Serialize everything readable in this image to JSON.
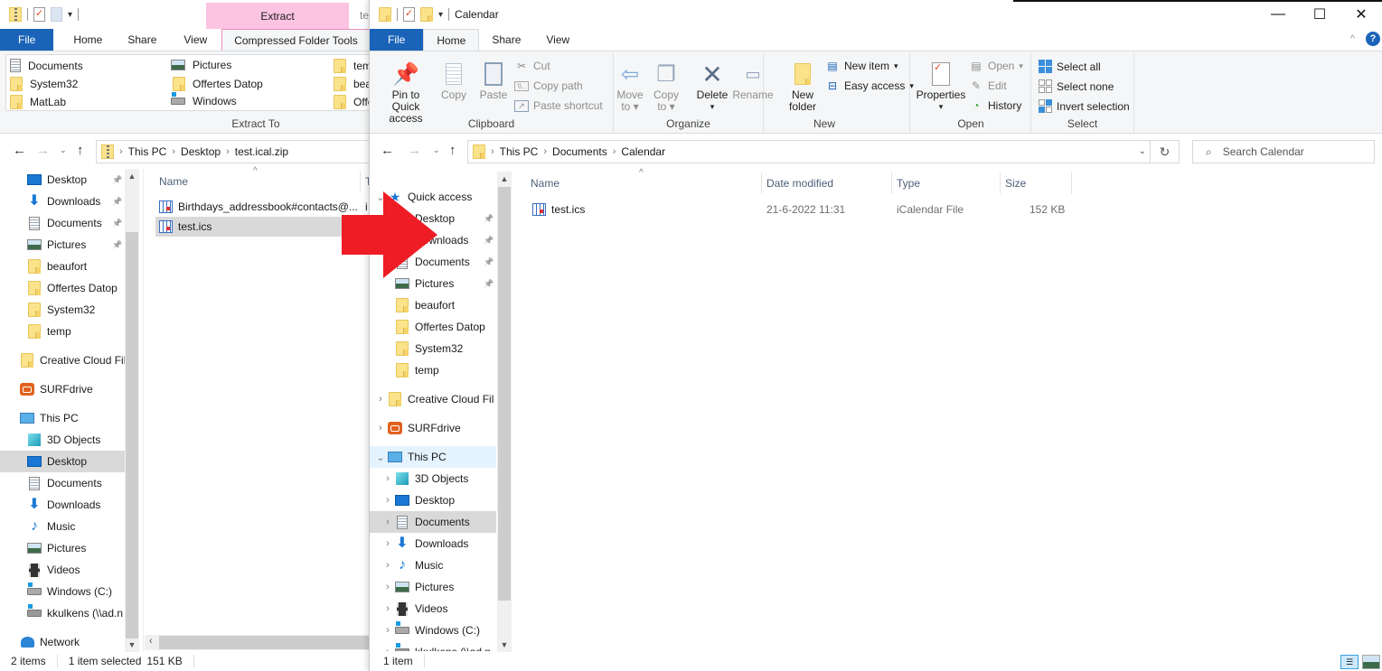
{
  "left_window": {
    "title_partial": "te",
    "contextual_tab_group": "Extract",
    "tabs": [
      {
        "label": "File"
      },
      {
        "label": "Home"
      },
      {
        "label": "Share"
      },
      {
        "label": "View"
      },
      {
        "label": "Compressed Folder Tools",
        "active": true
      }
    ],
    "extract_to": {
      "group_label": "Extract To",
      "items": [
        {
          "label": "Documents",
          "icon": "documents-icon"
        },
        {
          "label": "System32",
          "icon": "folder-icon"
        },
        {
          "label": "MatLab",
          "icon": "folder-icon"
        },
        {
          "label": "Pictures",
          "icon": "pictures-icon"
        },
        {
          "label": "Offertes Datop",
          "icon": "folder-icon"
        },
        {
          "label": "Windows",
          "icon": "drive-icon"
        },
        {
          "label": "tem",
          "icon": "folder-icon"
        },
        {
          "label": "bea",
          "icon": "folder-icon"
        },
        {
          "label": "Offe",
          "icon": "folder-icon"
        }
      ]
    },
    "address": {
      "crumbs": [
        "This PC",
        "Desktop",
        "test.ical.zip"
      ]
    },
    "nav": [
      {
        "label": "Desktop",
        "icon": "desktop-icon",
        "pinned": true
      },
      {
        "label": "Downloads",
        "icon": "downloads-icon",
        "pinned": true
      },
      {
        "label": "Documents",
        "icon": "documents-icon",
        "pinned": true
      },
      {
        "label": "Pictures",
        "icon": "pictures-icon",
        "pinned": true
      },
      {
        "label": "beaufort",
        "icon": "folder-icon"
      },
      {
        "label": "Offertes Datop",
        "icon": "folder-icon"
      },
      {
        "label": "System32",
        "icon": "folder-icon"
      },
      {
        "label": "temp",
        "icon": "folder-icon"
      },
      {
        "label": "Creative Cloud Fil",
        "icon": "folder-icon"
      },
      {
        "label": "SURFdrive",
        "icon": "surfdrive-icon"
      },
      {
        "label": "This PC",
        "icon": "computer-icon"
      },
      {
        "label": "3D Objects",
        "icon": "3d-objects-icon"
      },
      {
        "label": "Desktop",
        "icon": "desktop-icon",
        "selected": true
      },
      {
        "label": "Documents",
        "icon": "documents-icon"
      },
      {
        "label": "Downloads",
        "icon": "downloads-icon"
      },
      {
        "label": "Music",
        "icon": "music-icon"
      },
      {
        "label": "Pictures",
        "icon": "pictures-icon"
      },
      {
        "label": "Videos",
        "icon": "videos-icon"
      },
      {
        "label": "Windows (C:)",
        "icon": "drive-icon"
      },
      {
        "label": "kkulkens (\\\\ad.n",
        "icon": "network-drive-icon"
      },
      {
        "label": "Network",
        "icon": "network-icon"
      }
    ],
    "columns": {
      "name": "Name",
      "type_partial": "T"
    },
    "files": [
      {
        "name": "Birthdays_addressbook#contacts@...",
        "type_partial": "i"
      },
      {
        "name": "test.ics",
        "selected": true
      }
    ],
    "status": {
      "count": "2 items",
      "selection": "1 item selected",
      "size": "151 KB"
    }
  },
  "right_window": {
    "title": "Calendar",
    "tabs": [
      {
        "label": "File"
      },
      {
        "label": "Home",
        "active": true
      },
      {
        "label": "Share"
      },
      {
        "label": "View"
      }
    ],
    "ribbon": {
      "clipboard": {
        "label": "Clipboard",
        "pin": "Pin to Quick access",
        "pin_l1": "Pin to Quick",
        "pin_l2": "access",
        "copy": "Copy",
        "paste": "Paste",
        "cut": "Cut",
        "copy_path": "Copy path",
        "paste_shortcut": "Paste shortcut"
      },
      "organize": {
        "label": "Organize",
        "move_to_l1": "Move",
        "move_to_l2": "to",
        "copy_to_l1": "Copy",
        "copy_to_l2": "to",
        "delete": "Delete",
        "rename": "Rename"
      },
      "new": {
        "label": "New",
        "new_folder_l1": "New",
        "new_folder_l2": "folder",
        "new_item": "New item",
        "easy_access": "Easy access"
      },
      "open": {
        "label": "Open",
        "properties": "Properties",
        "open": "Open",
        "edit": "Edit",
        "history": "History"
      },
      "select": {
        "label": "Select",
        "select_all": "Select all",
        "select_none": "Select none",
        "invert": "Invert selection"
      }
    },
    "address": {
      "crumbs": [
        "This PC",
        "Documents",
        "Calendar"
      ]
    },
    "search": {
      "placeholder": "Search Calendar"
    },
    "nav": [
      {
        "label": "Quick access",
        "icon": "star-icon",
        "expanded": true
      },
      {
        "label": "Desktop",
        "icon": "desktop-icon",
        "pinned": true
      },
      {
        "label": "Downloads",
        "icon": "downloads-icon",
        "pinned": true
      },
      {
        "label": "Documents",
        "icon": "documents-icon",
        "pinned": true
      },
      {
        "label": "Pictures",
        "icon": "pictures-icon",
        "pinned": true
      },
      {
        "label": "beaufort",
        "icon": "folder-icon"
      },
      {
        "label": "Offertes Datop",
        "icon": "folder-icon"
      },
      {
        "label": "System32",
        "icon": "folder-icon"
      },
      {
        "label": "temp",
        "icon": "folder-icon"
      },
      {
        "label": "Creative Cloud Fil",
        "icon": "folder-icon"
      },
      {
        "label": "SURFdrive",
        "icon": "surfdrive-icon"
      },
      {
        "label": "This PC",
        "icon": "computer-icon",
        "expanded": true,
        "hover": true
      },
      {
        "label": "3D Objects",
        "icon": "3d-objects-icon"
      },
      {
        "label": "Desktop",
        "icon": "desktop-icon"
      },
      {
        "label": "Documents",
        "icon": "documents-icon",
        "selected": true
      },
      {
        "label": "Downloads",
        "icon": "downloads-icon"
      },
      {
        "label": "Music",
        "icon": "music-icon"
      },
      {
        "label": "Pictures",
        "icon": "pictures-icon"
      },
      {
        "label": "Videos",
        "icon": "videos-icon"
      },
      {
        "label": "Windows (C:)",
        "icon": "drive-icon"
      },
      {
        "label": "kkulkens (\\\\ad.n",
        "icon": "network-drive-icon"
      }
    ],
    "columns": {
      "name": "Name",
      "date": "Date modified",
      "type": "Type",
      "size": "Size"
    },
    "files": [
      {
        "name": "test.ics",
        "date": "21-6-2022 11:31",
        "type": "iCalendar File",
        "size": "152 KB"
      }
    ],
    "status": {
      "count": "1 item"
    }
  },
  "annotation": {
    "arrow_color": "#ee1c25"
  }
}
